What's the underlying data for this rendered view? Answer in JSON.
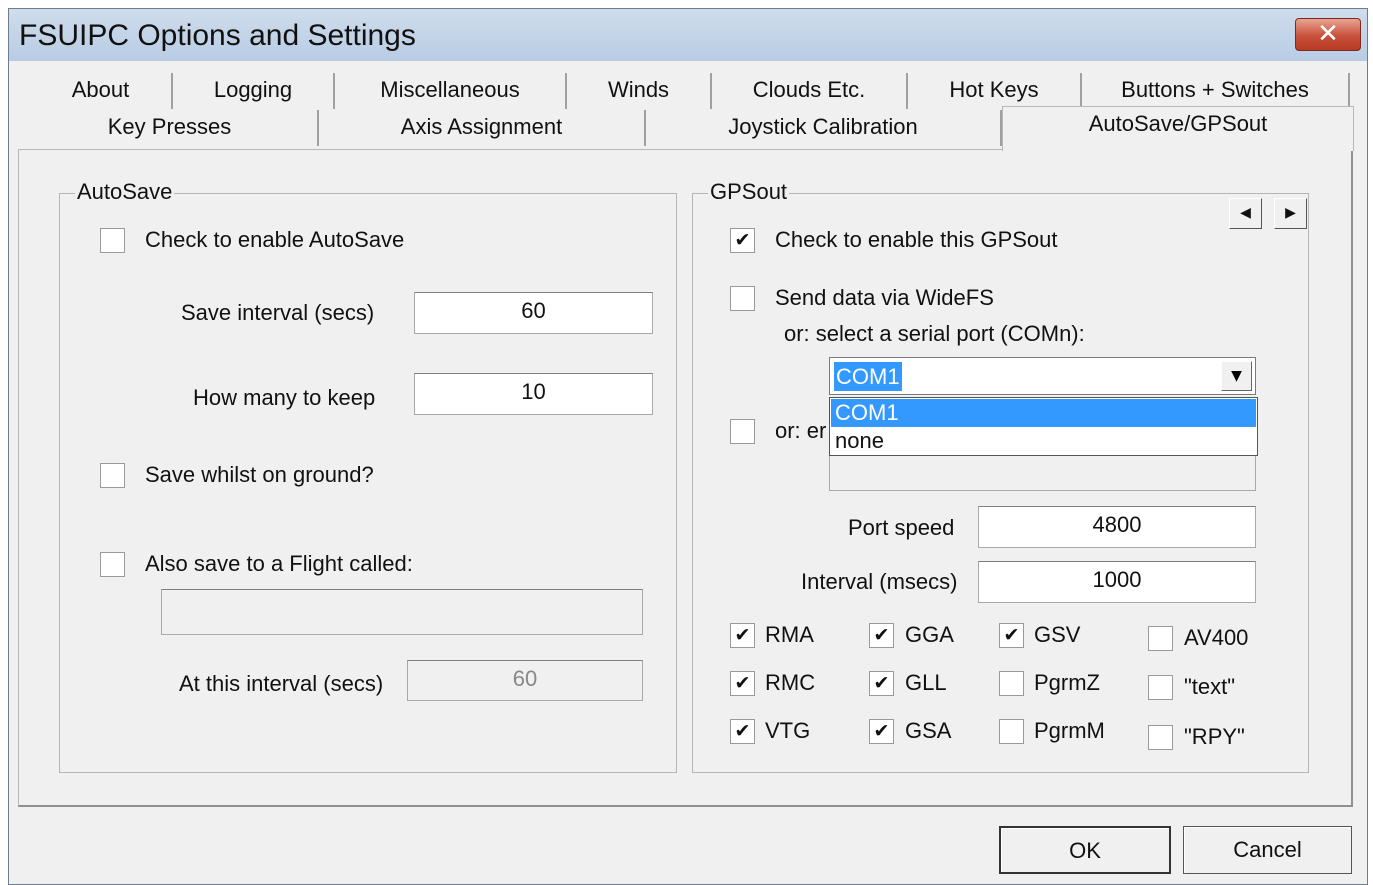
{
  "window": {
    "title": "FSUIPC Options and Settings",
    "close_glyph": "✕"
  },
  "tabs": {
    "row1": [
      "About",
      "Logging",
      "Miscellaneous",
      "Winds",
      "Clouds Etc.",
      "Hot Keys",
      "Buttons + Switches"
    ],
    "row2": [
      "Key Presses",
      "Axis Assignment",
      "Joystick Calibration",
      "AutoSave/GPSout"
    ],
    "active": "AutoSave/GPSout"
  },
  "autosave": {
    "title": "AutoSave",
    "enable_label": "Check to enable AutoSave",
    "enable_checked": false,
    "interval_label": "Save interval (secs)",
    "interval_value": "60",
    "keep_label": "How many to keep",
    "keep_value": "10",
    "ground_label": "Save whilst on ground?",
    "ground_checked": false,
    "flight_label": "Also save to a Flight called:",
    "flight_checked": false,
    "flight_name": "",
    "at_interval_label": "At this interval (secs)",
    "at_interval_value": "60"
  },
  "gpsout": {
    "title": "GPSout",
    "prev_glyph": "◀",
    "next_glyph": "▶",
    "enable_label": "Check to enable this GPSout",
    "enable_checked": true,
    "widefs_label": "Send data via WideFS",
    "widefs_checked": false,
    "serial_label": "or: select a serial port (COMn):",
    "port_value": "COM1",
    "port_options": [
      "COM1",
      "none"
    ],
    "port_selected_index": 0,
    "other_label_partial": "or: er",
    "other_checked": false,
    "other_value": "",
    "speed_label": "Port speed",
    "speed_value": "4800",
    "interval_label": "Interval (msecs)",
    "interval_value": "1000",
    "sentences": [
      {
        "label": "RMA",
        "checked": true
      },
      {
        "label": "GGA",
        "checked": true
      },
      {
        "label": "GSV",
        "checked": true
      },
      {
        "label": "AV400",
        "checked": false
      },
      {
        "label": "RMC",
        "checked": true
      },
      {
        "label": "GLL",
        "checked": true
      },
      {
        "label": "PgrmZ",
        "checked": false
      },
      {
        "label": "\"text\"",
        "checked": false
      },
      {
        "label": "VTG",
        "checked": true
      },
      {
        "label": "GSA",
        "checked": true
      },
      {
        "label": "PgrmM",
        "checked": false
      },
      {
        "label": "\"RPY\"",
        "checked": false
      }
    ]
  },
  "buttons": {
    "ok": "OK",
    "cancel": "Cancel"
  },
  "glyphs": {
    "check": "✔",
    "dropdown": "▼"
  },
  "colors": {
    "titlebar": "#c4d5ea",
    "selection": "#3399ff",
    "close": "#c7503a"
  }
}
